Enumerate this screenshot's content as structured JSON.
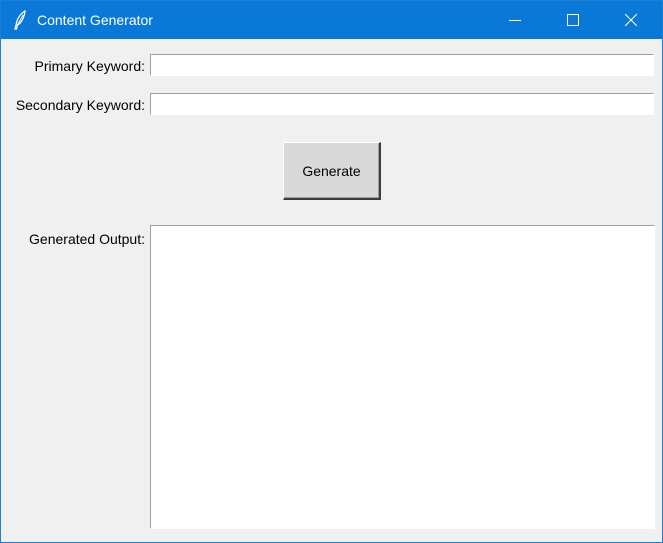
{
  "window": {
    "title": "Content Generator",
    "icon": "feather-icon",
    "controls": {
      "minimize_icon": "minimize-icon",
      "maximize_icon": "maximize-icon",
      "close_icon": "close-icon"
    },
    "accent_color": "#0a78d7"
  },
  "form": {
    "primary_label": "Primary Keyword:",
    "primary_value": "",
    "secondary_label": "Secondary Keyword:",
    "secondary_value": "",
    "generate_label": "Generate",
    "output_label": "Generated Output:",
    "output_value": ""
  }
}
